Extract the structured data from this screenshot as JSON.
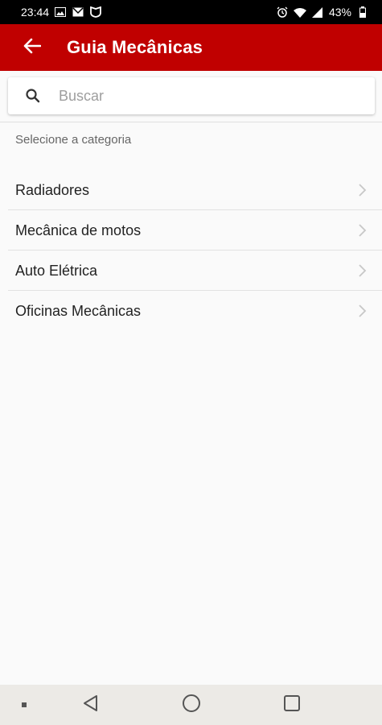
{
  "status_bar": {
    "time": "23:44",
    "battery": "43%",
    "left_icons": [
      "gallery-icon",
      "mail-icon",
      "shield-app-icon"
    ],
    "right_icons": [
      "alarm-icon",
      "wifi-icon",
      "signal-icon",
      "battery-icon"
    ]
  },
  "app_bar": {
    "title": "Guia Mecânicas",
    "back_icon": "arrow-left-icon",
    "color": "#c00000"
  },
  "search": {
    "placeholder": "Buscar",
    "value": "",
    "icon": "search-icon"
  },
  "section_label": "Selecione a categoria",
  "categories": [
    {
      "label": "Radiadores"
    },
    {
      "label": "Mecânica de motos"
    },
    {
      "label": "Auto Elétrica"
    },
    {
      "label": "Oficinas Mecânicas"
    }
  ],
  "nav_bar": {
    "buttons": [
      "menu-dot-icon",
      "back-triangle-icon",
      "home-circle-icon",
      "recents-square-icon"
    ]
  }
}
